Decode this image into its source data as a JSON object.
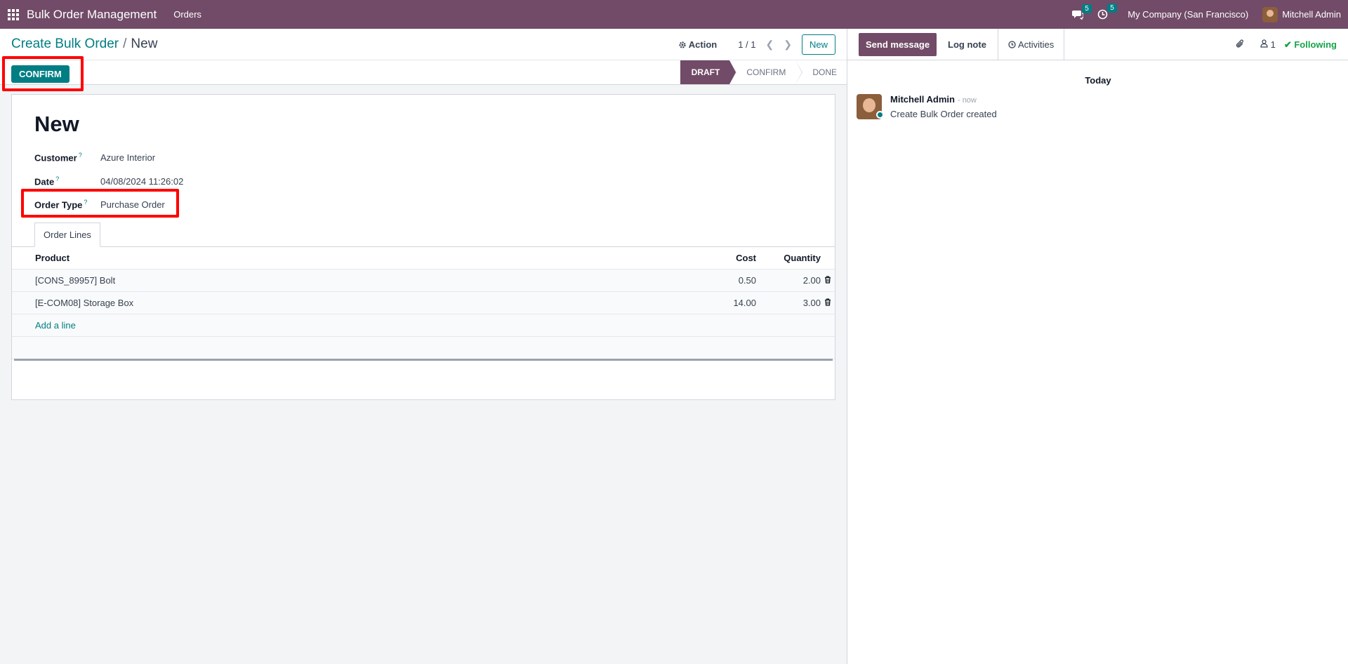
{
  "navbar": {
    "app_name": "Bulk Order Management",
    "menu_orders": "Orders",
    "messages_count": "5",
    "activities_count": "5",
    "company": "My Company (San Francisco)",
    "user": "Mitchell Admin"
  },
  "control_panel": {
    "breadcrumb_parent": "Create Bulk Order",
    "breadcrumb_sep": "/",
    "breadcrumb_current": "New",
    "action_label": "Action",
    "pager": "1 / 1",
    "new_label": "New",
    "confirm_label": "CONFIRM",
    "stages": [
      "DRAFT",
      "CONFIRM",
      "DONE"
    ],
    "active_stage": "DRAFT"
  },
  "form": {
    "title": "New",
    "customer_label": "Customer",
    "customer_value": "Azure Interior",
    "date_label": "Date",
    "date_value": "04/08/2024 11:26:02",
    "order_type_label": "Order Type",
    "order_type_value": "Purchase Order",
    "help_mark": "?",
    "tab_label": "Order Lines",
    "columns": {
      "product": "Product",
      "cost": "Cost",
      "quantity": "Quantity"
    },
    "lines": [
      {
        "product": "[CONS_89957] Bolt",
        "cost": "0.50",
        "quantity": "2.00"
      },
      {
        "product": "[E-COM08] Storage Box",
        "cost": "14.00",
        "quantity": "3.00"
      }
    ],
    "add_line": "Add a line"
  },
  "chatter": {
    "send_message": "Send message",
    "log_note": "Log note",
    "activities": "Activities",
    "followers_count": "1",
    "following": "Following",
    "date_separator": "Today",
    "message_author": "Mitchell Admin",
    "message_time": "- now",
    "message_body": "Create Bulk Order created"
  },
  "colors": {
    "brand": "#714b67",
    "accent": "#017e84",
    "highlight": "#ff0000",
    "following": "#16a34a"
  }
}
